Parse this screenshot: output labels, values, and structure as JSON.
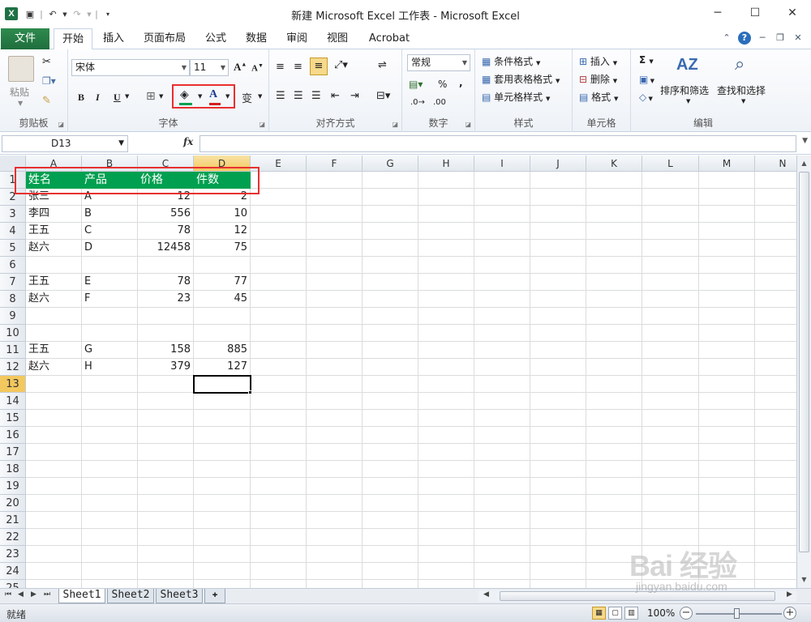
{
  "window": {
    "title": "新建 Microsoft Excel 工作表 - Microsoft Excel",
    "app_icon": "X"
  },
  "quick_access": [
    "save-icon",
    "undo-icon",
    "redo-icon",
    "customize-icon"
  ],
  "tabs": {
    "file": "文件",
    "items": [
      "开始",
      "插入",
      "页面布局",
      "公式",
      "数据",
      "审阅",
      "视图",
      "Acrobat"
    ],
    "active": "开始"
  },
  "ribbon": {
    "clipboard": {
      "label": "剪贴板",
      "paste": "粘贴"
    },
    "font": {
      "label": "字体",
      "font_name": "宋体",
      "font_size": "11",
      "bold": "B",
      "italic": "I",
      "underline": "U",
      "font_color": "A",
      "grow": "A",
      "shrink": "A",
      "phonetic": "变"
    },
    "alignment": {
      "label": "对齐方式"
    },
    "number": {
      "label": "数字",
      "format": "常规",
      "percent": "%",
      "comma": ","
    },
    "styles": {
      "label": "样式",
      "conditional": "条件格式",
      "table": "套用表格格式",
      "cell_styles": "单元格样式"
    },
    "cells": {
      "label": "单元格",
      "insert": "插入",
      "delete": "删除",
      "format": "格式"
    },
    "editing": {
      "label": "编辑",
      "sum": "Σ",
      "sort": "排序和筛选",
      "find": "查找和选择"
    }
  },
  "formula_bar": {
    "name_box": "D13",
    "fx": "fx",
    "content": ""
  },
  "sheet": {
    "columns": [
      "A",
      "B",
      "C",
      "D",
      "E",
      "F",
      "G",
      "H",
      "I",
      "J",
      "K",
      "L",
      "M",
      "N"
    ],
    "selected_column": "D",
    "rows": [
      "1",
      "2",
      "3",
      "4",
      "5",
      "6",
      "7",
      "8",
      "9",
      "10",
      "11",
      "12",
      "13",
      "14",
      "15",
      "16",
      "17",
      "18",
      "19",
      "20",
      "21",
      "22",
      "23",
      "24",
      "25"
    ],
    "selected_row": "13",
    "header": [
      "姓名",
      "产品",
      "价格",
      "件数"
    ],
    "data": [
      [
        "张三",
        "A",
        "12",
        "2"
      ],
      [
        "李四",
        "B",
        "556",
        "10"
      ],
      [
        "王五",
        "C",
        "78",
        "12"
      ],
      [
        "赵六",
        "D",
        "12458",
        "75"
      ],
      [
        "",
        "",
        "",
        ""
      ],
      [
        "王五",
        "E",
        "78",
        "77"
      ],
      [
        "赵六",
        "F",
        "23",
        "45"
      ],
      [
        "",
        "",
        "",
        ""
      ],
      [
        "",
        "",
        "",
        ""
      ],
      [
        "王五",
        "G",
        "158",
        "885"
      ],
      [
        "赵六",
        "H",
        "379",
        "127"
      ]
    ],
    "header_fill": "#00a050",
    "active_cell": "D13"
  },
  "sheet_tabs": [
    "Sheet1",
    "Sheet2",
    "Sheet3"
  ],
  "active_sheet": "Sheet1",
  "status": {
    "text": "就绪",
    "zoom": "100%"
  },
  "watermark": {
    "text": "Bai 经验",
    "url": "jingyan.baidu.com"
  },
  "highlight_color": "#e8302f"
}
